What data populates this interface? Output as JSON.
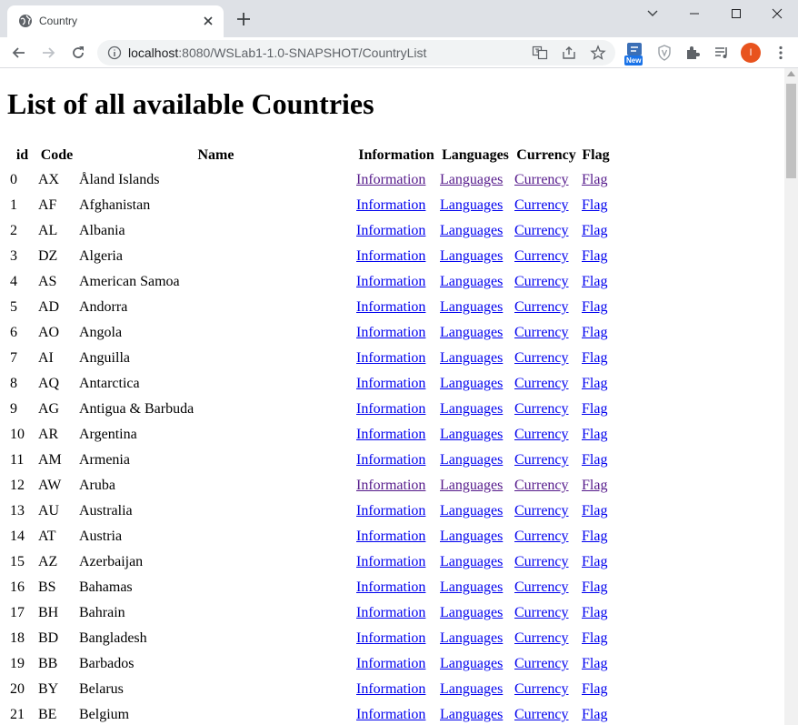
{
  "browser": {
    "tab_title": "Country",
    "url_host": "localhost",
    "url_path": ":8080/WSLab1-1.0-SNAPSHOT/CountryList",
    "extension_badge": "New",
    "profile_initial": "I"
  },
  "page": {
    "title": "List of all available Countries",
    "headers": {
      "id": "id",
      "code": "Code",
      "name": "Name",
      "information": "Information",
      "languages": "Languages",
      "currency": "Currency",
      "flag": "Flag"
    },
    "link_labels": {
      "information": "Information",
      "languages": "Languages",
      "currency": "Currency",
      "flag": "Flag"
    },
    "rows": [
      {
        "id": "0",
        "code": "AX",
        "name": "Åland Islands",
        "visited": true
      },
      {
        "id": "1",
        "code": "AF",
        "name": "Afghanistan",
        "visited": false
      },
      {
        "id": "2",
        "code": "AL",
        "name": "Albania",
        "visited": false
      },
      {
        "id": "3",
        "code": "DZ",
        "name": "Algeria",
        "visited": false
      },
      {
        "id": "4",
        "code": "AS",
        "name": "American Samoa",
        "visited": false
      },
      {
        "id": "5",
        "code": "AD",
        "name": "Andorra",
        "visited": false
      },
      {
        "id": "6",
        "code": "AO",
        "name": "Angola",
        "visited": false
      },
      {
        "id": "7",
        "code": "AI",
        "name": "Anguilla",
        "visited": false
      },
      {
        "id": "8",
        "code": "AQ",
        "name": "Antarctica",
        "visited": false
      },
      {
        "id": "9",
        "code": "AG",
        "name": "Antigua & Barbuda",
        "visited": false
      },
      {
        "id": "10",
        "code": "AR",
        "name": "Argentina",
        "visited": false
      },
      {
        "id": "11",
        "code": "AM",
        "name": "Armenia",
        "visited": false
      },
      {
        "id": "12",
        "code": "AW",
        "name": "Aruba",
        "visited": true
      },
      {
        "id": "13",
        "code": "AU",
        "name": "Australia",
        "visited": false
      },
      {
        "id": "14",
        "code": "AT",
        "name": "Austria",
        "visited": false
      },
      {
        "id": "15",
        "code": "AZ",
        "name": "Azerbaijan",
        "visited": false
      },
      {
        "id": "16",
        "code": "BS",
        "name": "Bahamas",
        "visited": false
      },
      {
        "id": "17",
        "code": "BH",
        "name": "Bahrain",
        "visited": false
      },
      {
        "id": "18",
        "code": "BD",
        "name": "Bangladesh",
        "visited": false
      },
      {
        "id": "19",
        "code": "BB",
        "name": "Barbados",
        "visited": false
      },
      {
        "id": "20",
        "code": "BY",
        "name": "Belarus",
        "visited": false
      },
      {
        "id": "21",
        "code": "BE",
        "name": "Belgium",
        "visited": false
      }
    ]
  },
  "colors": {
    "link": "#0000ee",
    "visited_link": "#551a8b",
    "tab_strip": "#dee1e6",
    "omnibox": "#f1f3f4",
    "avatar": "#e8531e"
  }
}
